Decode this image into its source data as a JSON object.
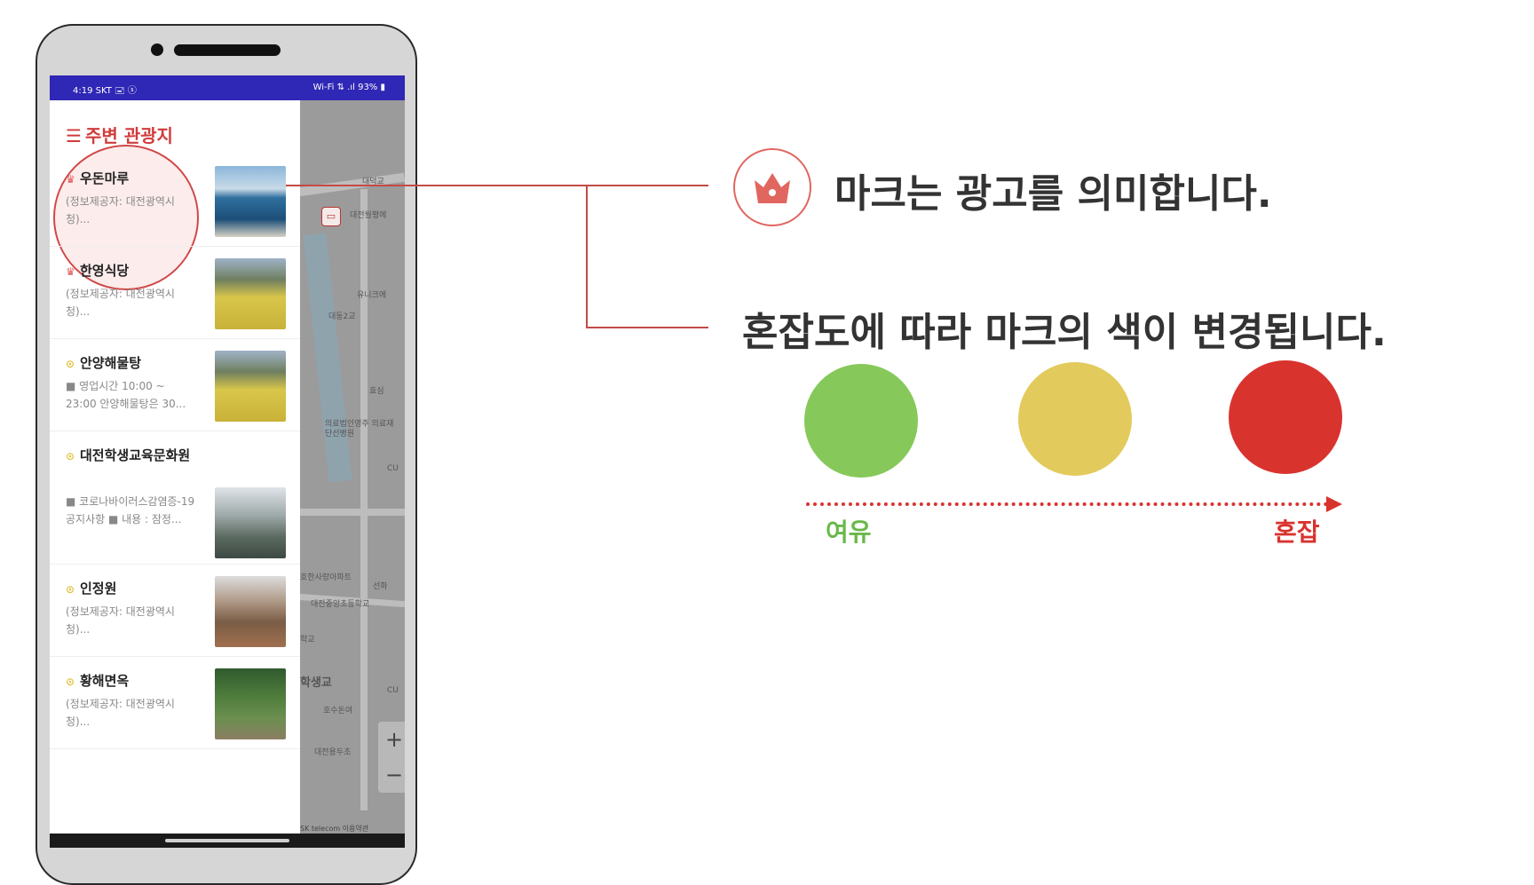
{
  "status_bar": {
    "time": "4:19 SKT 🖃 ⓢ",
    "system": "Wi-Fi ⇅ .ıl 93% ▮"
  },
  "drawer": {
    "title": "주변 관광지",
    "items": [
      {
        "badge": "ad",
        "title": "우돈마루",
        "desc": "(정보제공자: 대전광역시 청)...",
        "image": "sea"
      },
      {
        "badge": "ad",
        "title": "한영식당",
        "desc": "(정보제공자: 대전광역시 청)...",
        "image": "field"
      },
      {
        "badge": "low",
        "title": "안양해물탕",
        "desc": "■ 영업시간 10:00 ~ 23:00 안양해물탕은 30...",
        "image": "field"
      },
      {
        "badge": "low",
        "title": "대전학생교육문화원",
        "desc": "■ 코로나바이러스감염증-19 공지사항 ■ 내용 : 잠정...",
        "image": "building"
      },
      {
        "badge": "low",
        "title": "인정원",
        "desc": "(정보제공자: 대전광역시 청)...",
        "image": "trees"
      },
      {
        "badge": "low",
        "title": "황해면옥",
        "desc": "(정보제공자: 대전광역시 청)...",
        "image": "forest"
      }
    ]
  },
  "map": {
    "labels": [
      "대전월평에",
      "대덕교",
      "유니크에",
      "대동2교",
      "의료법인영주 의료재단선병원",
      "효심",
      "CU",
      "호한사랑아파트",
      "선화",
      "대전중앙초등학교",
      "학생교",
      "학교",
      "호수돈여",
      "대전용두초",
      "CU"
    ],
    "zoom_in": "+",
    "zoom_out": "−",
    "copyright": "SK telecom  이용약관"
  },
  "legend": {
    "ad_text": "마크는 광고를 의미합니다.",
    "change_text": "혼잡도에 따라 마크의 색이 변경됩니다.",
    "low_label": "여유",
    "high_label": "혼잡",
    "colors": {
      "low": "#86c95a",
      "mid": "#e3ca5c",
      "high": "#d9332e",
      "accent": "#e0665f"
    }
  },
  "icons": {
    "menu": "menu-icon",
    "ad_badge": "crown-icon",
    "congestion_badge": "chevron-circle-icon"
  }
}
